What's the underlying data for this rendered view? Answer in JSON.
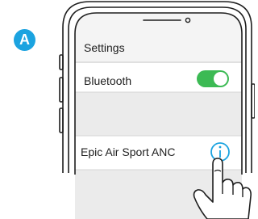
{
  "step_label": "A",
  "settings": {
    "title": "Settings",
    "bluetooth": {
      "label": "Bluetooth",
      "enabled": true
    },
    "device": {
      "name": "Epic Air Sport ANC",
      "info_icon": "info-icon"
    }
  },
  "colors": {
    "badge": "#1ba3e0",
    "toggle_on": "#3cba54",
    "info": "#1ba3e0",
    "screen_gray": "#ebebeb",
    "outline": "#1e1e1e"
  }
}
